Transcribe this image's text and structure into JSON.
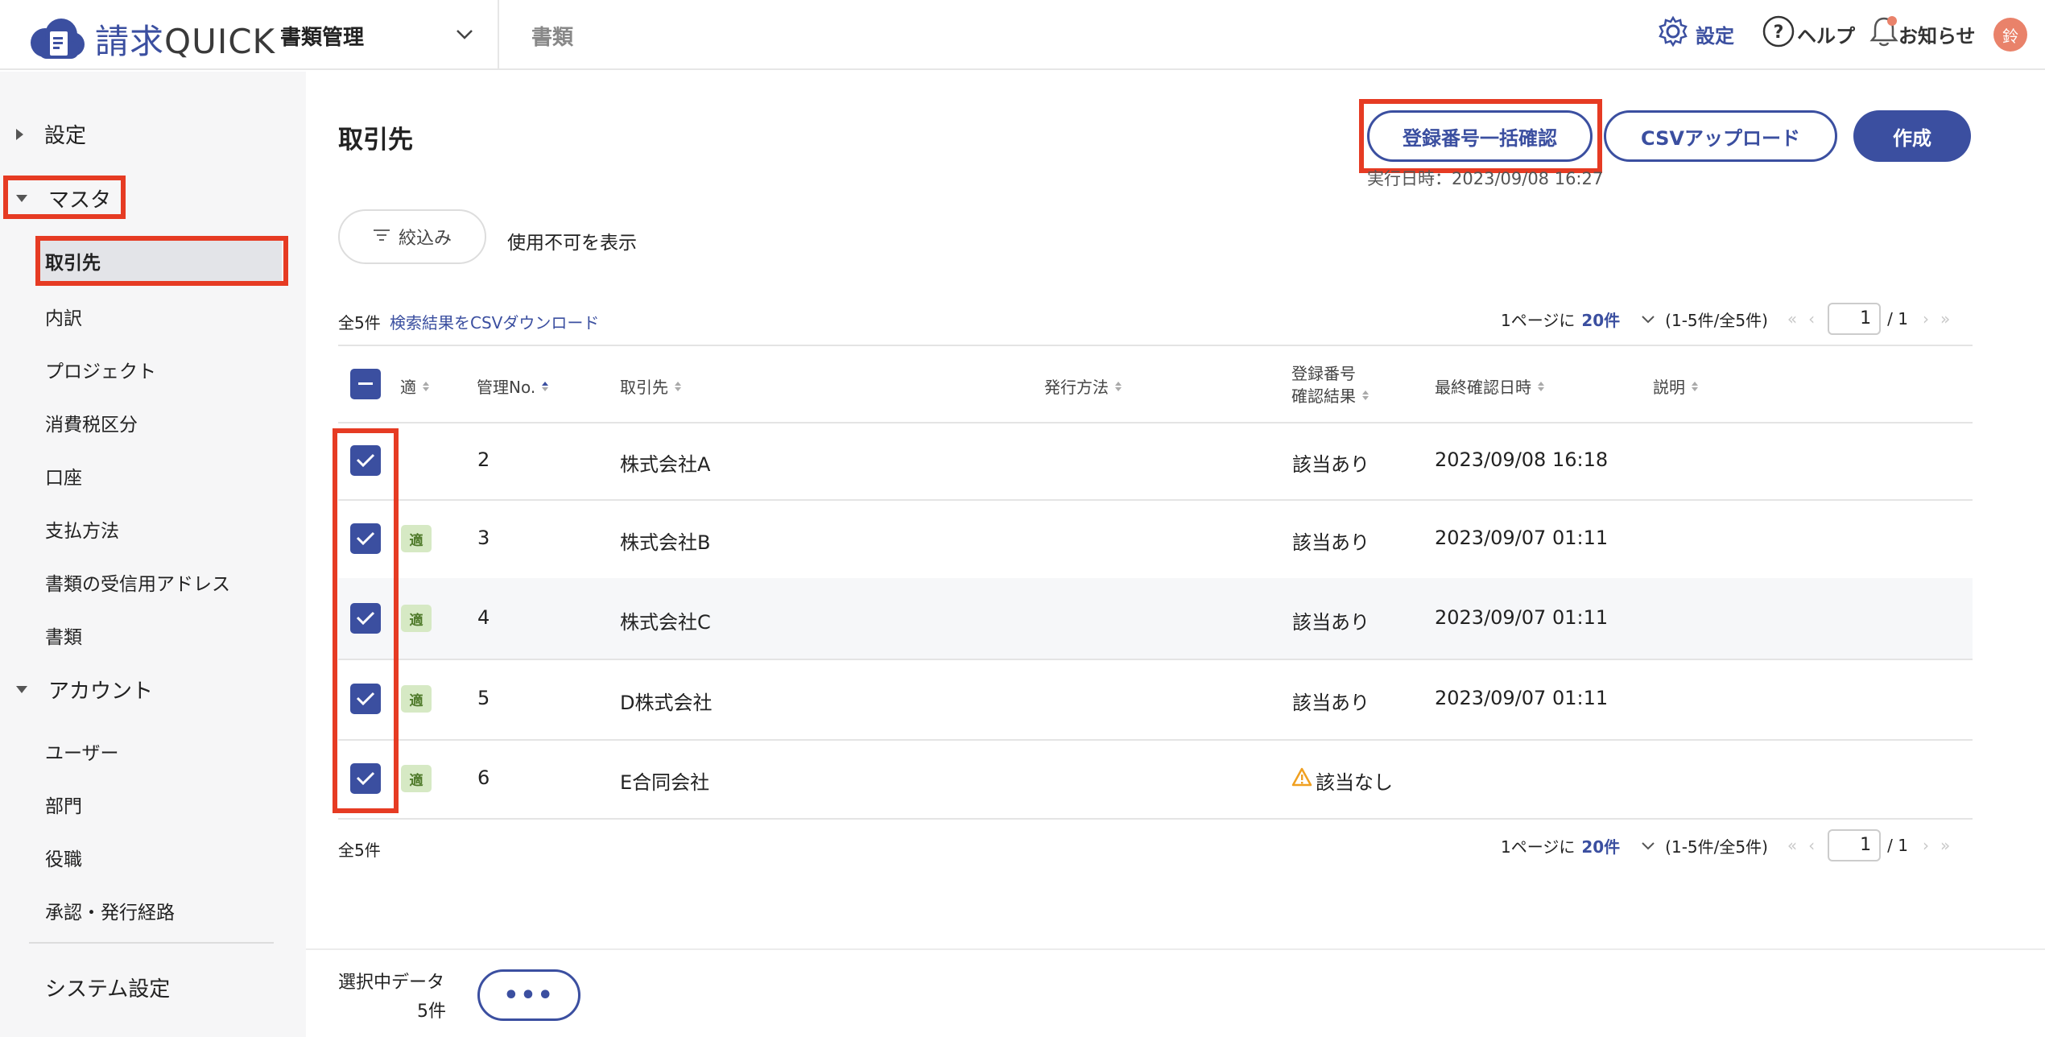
{
  "header": {
    "logo_brand": "請求",
    "logo_suffix": "QUICK",
    "module": "書類管理",
    "tab": "書類",
    "settings": "設定",
    "help": "ヘルプ",
    "notifications": "お知らせ",
    "avatar_initial": "鈴"
  },
  "sidebar": {
    "sections": [
      {
        "label": "設定",
        "expanded": false
      },
      {
        "label": "マスタ",
        "expanded": true
      },
      {
        "label": "アカウント",
        "expanded": true
      }
    ],
    "master_items": [
      "取引先",
      "内訳",
      "プロジェクト",
      "消費税区分",
      "口座",
      "支払方法",
      "書類の受信用アドレス",
      "書類"
    ],
    "account_items": [
      "ユーザー",
      "部門",
      "役職",
      "承認・発行経路"
    ],
    "system": "システム設定"
  },
  "main": {
    "title": "取引先",
    "bulk_check_button": "登録番号一括確認",
    "csv_upload_button": "CSVアップロード",
    "create_button": "作成",
    "exec_time": "実行日時：2023/09/08 16:27",
    "filter_button": "絞込み",
    "show_disabled": "使用不可を表示",
    "total": "全5件",
    "csv_download": "検索結果をCSVダウンロード",
    "per_page_prefix": "1ページに",
    "per_page_value": "20件",
    "range": "(1-5件/全5件)",
    "page_current": "1",
    "page_total": "/ 1"
  },
  "table": {
    "headers": {
      "tekikaku": "適",
      "no": "管理No.",
      "client": "取引先",
      "method": "発行方法",
      "reg_line1": "登録番号",
      "reg_line2": "確認結果",
      "last_check": "最終確認日時",
      "desc": "説明"
    },
    "badge_label": "適",
    "rows": [
      {
        "no": "2",
        "client": "株式会社A",
        "result": "該当あり",
        "date": "2023/09/08 16:18",
        "badge": false,
        "warn": false
      },
      {
        "no": "3",
        "client": "株式会社B",
        "result": "該当あり",
        "date": "2023/09/07 01:11",
        "badge": true,
        "warn": false
      },
      {
        "no": "4",
        "client": "株式会社C",
        "result": "該当あり",
        "date": "2023/09/07 01:11",
        "badge": true,
        "warn": false
      },
      {
        "no": "5",
        "client": "D株式会社",
        "result": "該当あり",
        "date": "2023/09/07 01:11",
        "badge": true,
        "warn": false
      },
      {
        "no": "6",
        "client": "E合同会社",
        "result": "該当なし",
        "date": "",
        "badge": true,
        "warn": true
      }
    ]
  },
  "footer": {
    "selected_label": "選択中データ",
    "selected_count": "5件",
    "more": "•••"
  },
  "colors": {
    "primary": "#3b4fa0",
    "highlight": "#e63b23",
    "badge_bg": "#d6e9c4",
    "warning": "#f0a020"
  }
}
